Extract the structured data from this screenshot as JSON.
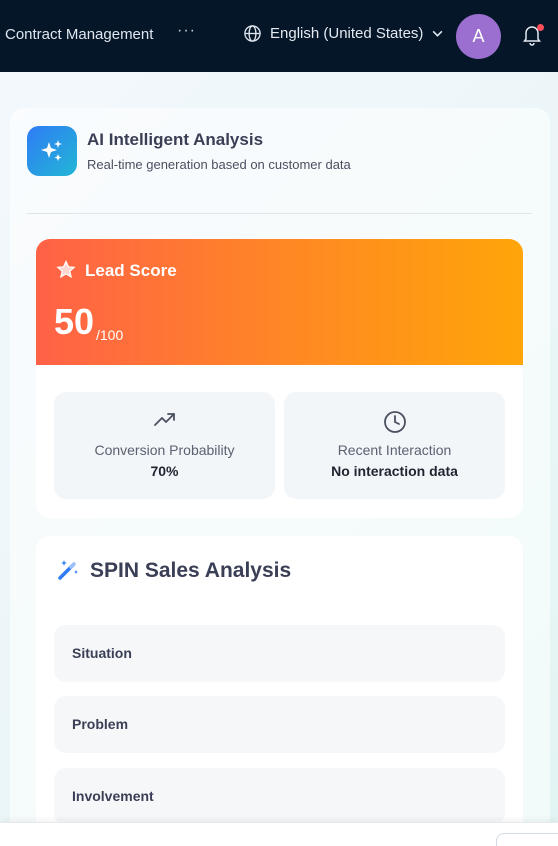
{
  "header": {
    "title": "Contract Management",
    "more_icon": "more-horizontal-icon",
    "language": "English (United States)",
    "avatar_initial": "A",
    "notification_badge_color": "#ff4d5a"
  },
  "ai_panel": {
    "title": "AI Intelligent Analysis",
    "subtitle": "Real-time generation based on customer data",
    "icon": "sparkles-icon"
  },
  "lead_score": {
    "label": "Lead Score",
    "score": "50",
    "max": "/100",
    "gradient": [
      "#ff6147",
      "#ffa509"
    ],
    "stats": [
      {
        "icon": "trend-up-icon",
        "label": "Conversion Probability",
        "value": "70%"
      },
      {
        "icon": "clock-icon",
        "label": "Recent Interaction",
        "value": "No interaction data"
      }
    ]
  },
  "spin": {
    "title": "SPIN Sales Analysis",
    "icon": "magic-wand-icon",
    "items": [
      {
        "label": "Situation"
      },
      {
        "label": "Problem"
      },
      {
        "label": "Involvement"
      }
    ]
  },
  "colors": {
    "topbar": "#051628",
    "avatar": "#9b6fd0",
    "accent_blue": "#2f7cf6"
  }
}
